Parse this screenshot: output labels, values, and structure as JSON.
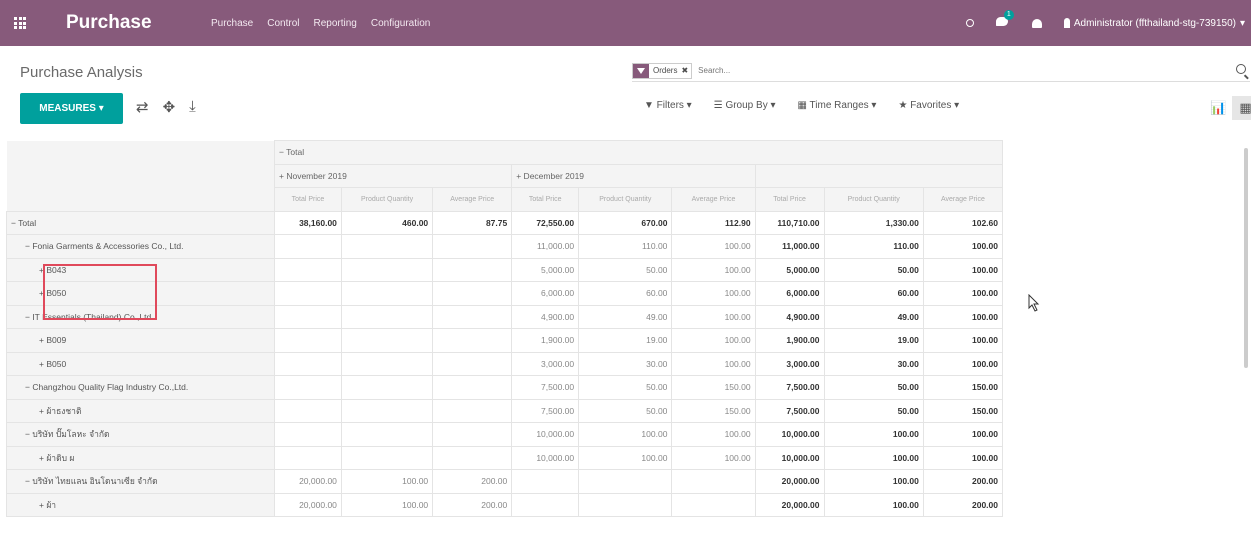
{
  "navbar": {
    "app_title": "Purchase",
    "menu": [
      "Purchase",
      "Control",
      "Reporting",
      "Configuration"
    ],
    "chat_badge": "1",
    "user": "Administrator (ffthailand-stg-739150)",
    "accent": "#875a7b"
  },
  "control": {
    "breadcrumb": "Purchase Analysis",
    "facet": "Orders",
    "search_placeholder": "Search...",
    "measures_label": "MEASURES ▾",
    "filters": "▼ Filters ▾",
    "group_by": "☰ Group By ▾",
    "time_ranges": "▦ Time Ranges ▾",
    "favorites": "★ Favorites ▾",
    "button_color": "#00a09d"
  },
  "pivot": {
    "col_total": "− Total",
    "col_groups": [
      "+ November 2019",
      "+ December 2019"
    ],
    "measures": [
      "Total Price",
      "Product Quantity",
      "Average Price"
    ],
    "rows": [
      {
        "label": "− Total",
        "indent": 0,
        "cells": [
          "38,160.00",
          "460.00",
          "87.75",
          "72,550.00",
          "670.00",
          "112.90",
          "110,710.00",
          "1,330.00",
          "102.60"
        ],
        "total": true
      },
      {
        "label": "− Fonia Garments & Accessories Co., Ltd.",
        "indent": 1,
        "cells": [
          "",
          "",
          "",
          "11,000.00",
          "110.00",
          "100.00",
          "11,000.00",
          "110.00",
          "100.00"
        ]
      },
      {
        "label": "+ B043",
        "indent": 2,
        "cells": [
          "",
          "",
          "",
          "5,000.00",
          "50.00",
          "100.00",
          "5,000.00",
          "50.00",
          "100.00"
        ]
      },
      {
        "label": "+ B050",
        "indent": 2,
        "cells": [
          "",
          "",
          "",
          "6,000.00",
          "60.00",
          "100.00",
          "6,000.00",
          "60.00",
          "100.00"
        ]
      },
      {
        "label": "− IT Essentials (Thailand) Co.,Ltd.",
        "indent": 1,
        "cells": [
          "",
          "",
          "",
          "4,900.00",
          "49.00",
          "100.00",
          "4,900.00",
          "49.00",
          "100.00"
        ]
      },
      {
        "label": "+ B009",
        "indent": 2,
        "cells": [
          "",
          "",
          "",
          "1,900.00",
          "19.00",
          "100.00",
          "1,900.00",
          "19.00",
          "100.00"
        ]
      },
      {
        "label": "+ B050",
        "indent": 2,
        "cells": [
          "",
          "",
          "",
          "3,000.00",
          "30.00",
          "100.00",
          "3,000.00",
          "30.00",
          "100.00"
        ]
      },
      {
        "label": "− Changzhou Quality Flag Industry Co.,Ltd.",
        "indent": 1,
        "cells": [
          "",
          "",
          "",
          "7,500.00",
          "50.00",
          "150.00",
          "7,500.00",
          "50.00",
          "150.00"
        ]
      },
      {
        "label": "+ ผ้าธงชาติ",
        "indent": 2,
        "cells": [
          "",
          "",
          "",
          "7,500.00",
          "50.00",
          "150.00",
          "7,500.00",
          "50.00",
          "150.00"
        ]
      },
      {
        "label": "− บริษัท ปั๊มโลหะ จำกัด",
        "indent": 1,
        "cells": [
          "",
          "",
          "",
          "10,000.00",
          "100.00",
          "100.00",
          "10,000.00",
          "100.00",
          "100.00"
        ]
      },
      {
        "label": "+ ผ้าดิบ ผ",
        "indent": 2,
        "cells": [
          "",
          "",
          "",
          "10,000.00",
          "100.00",
          "100.00",
          "10,000.00",
          "100.00",
          "100.00"
        ]
      },
      {
        "label": "− บริษัท ไทยแลน อินโดนาเซีย จำกัด",
        "indent": 1,
        "cells": [
          "20,000.00",
          "100.00",
          "200.00",
          "",
          "",
          "",
          "20,000.00",
          "100.00",
          "200.00"
        ]
      },
      {
        "label": "+ ผ้า",
        "indent": 2,
        "cells": [
          "20,000.00",
          "100.00",
          "200.00",
          "",
          "",
          "",
          "20,000.00",
          "100.00",
          "200.00"
        ]
      }
    ]
  }
}
